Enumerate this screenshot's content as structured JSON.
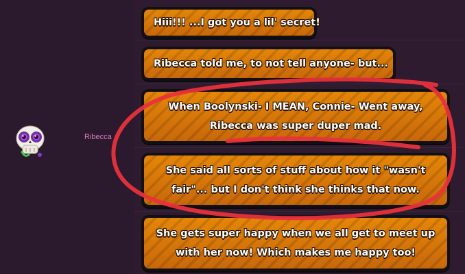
{
  "sender": {
    "name": "Ribecca",
    "avatar_icon": "skull-icon"
  },
  "messages": [
    {
      "lines": [
        "Hiii!!! ...I got you a lil' secret!"
      ]
    },
    {
      "lines": [
        "Ribecca told me, to not tell anyone- but..."
      ]
    },
    {
      "lines": [
        "When Boolynski- I MEAN, Connie- Went away,",
        "Ribecca was super duper mad."
      ]
    },
    {
      "lines": [
        "She said all sorts of stuff about how it \"wasn't",
        "fair\"... but I don't think she thinks that now."
      ]
    },
    {
      "lines": [
        "She gets super happy when we all get to meet up",
        "with her now! Which makes me happy too!"
      ]
    }
  ],
  "colors": {
    "background": "#2e1b30",
    "bubble_fill": "#d9780a",
    "bubble_border": "#121012",
    "name_color": "#d77ec0",
    "annotation_stroke": "#e8323c"
  }
}
